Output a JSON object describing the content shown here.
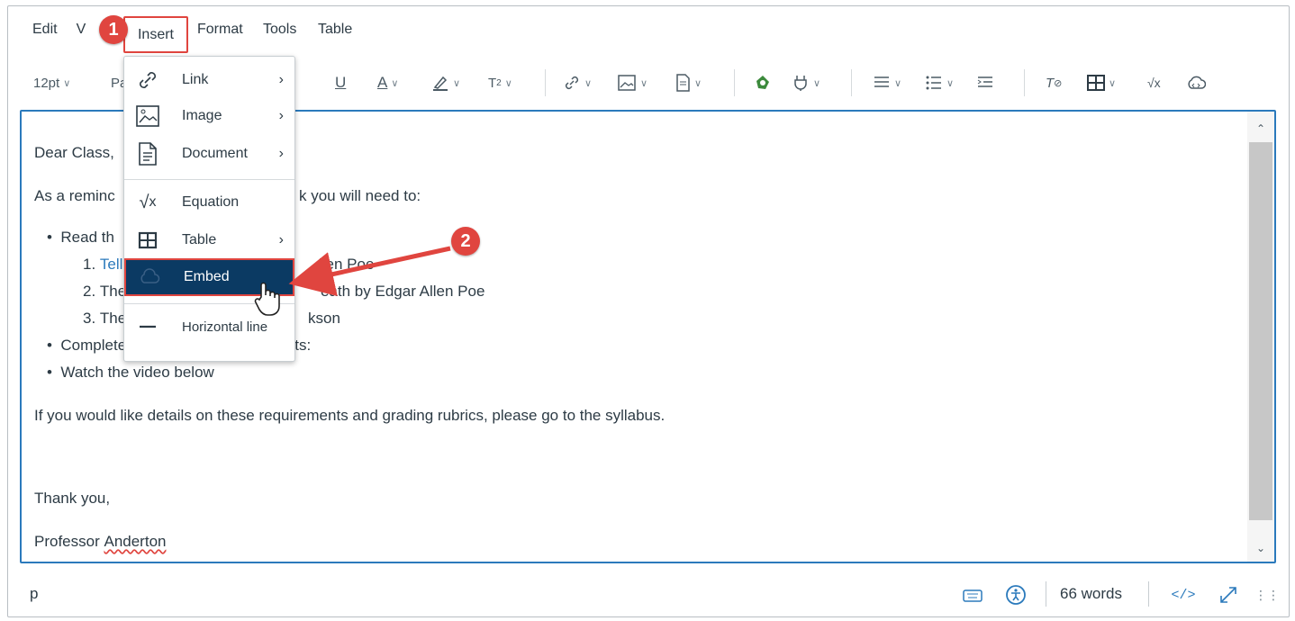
{
  "menubar": {
    "items": [
      "Edit",
      "V",
      "Insert",
      "Format",
      "Tools",
      "Table"
    ]
  },
  "toolbar": {
    "font_size": "12pt",
    "paragraph_abbrev": "Pa"
  },
  "insert_menu": {
    "items": [
      {
        "label": "Link",
        "icon": "link-icon",
        "submenu": true
      },
      {
        "label": "Image",
        "icon": "image-icon",
        "submenu": true
      },
      {
        "label": "Document",
        "icon": "document-icon",
        "submenu": true
      },
      {
        "label": "Equation",
        "icon": "equation-icon",
        "submenu": false
      },
      {
        "label": "Table",
        "icon": "table-icon",
        "submenu": true
      },
      {
        "label": "Embed",
        "icon": "embed-icon",
        "submenu": false,
        "highlighted": true
      },
      {
        "label": "Horizontal line",
        "icon": "horizontal-line-icon",
        "submenu": false
      }
    ]
  },
  "callouts": {
    "step1": "1",
    "step2": "2"
  },
  "content": {
    "greeting": "Dear Class,",
    "reminder_start": "As a reminc",
    "reminder_end": "k you will need to:",
    "bullet_read": "Read th",
    "ol1_num": "1.",
    "ol1_link": "Tell",
    "ol1_rest": "llen Poe",
    "ol2_num": "2.",
    "ol2_start": "The",
    "ol2_rest": "eath by Edgar Allen Poe",
    "ol3_num": "3.",
    "ol3_start": "The",
    "ol3_rest": "kson",
    "bullet_complete": "Complete the following Assignments:",
    "bullet_watch": "Watch the video below",
    "details": "If you would like details on these requirements and grading rubrics, please go to the syllabus.",
    "closing": "Thank you,",
    "signature_first": "Professor",
    "signature_last": "Anderton"
  },
  "statusbar": {
    "path": "p",
    "word_count": "66 words",
    "html_toggle": "</>"
  },
  "colors": {
    "accent_red": "#e0453f",
    "focus_blue": "#2b7abc",
    "menu_highlight": "#0b3a63"
  }
}
